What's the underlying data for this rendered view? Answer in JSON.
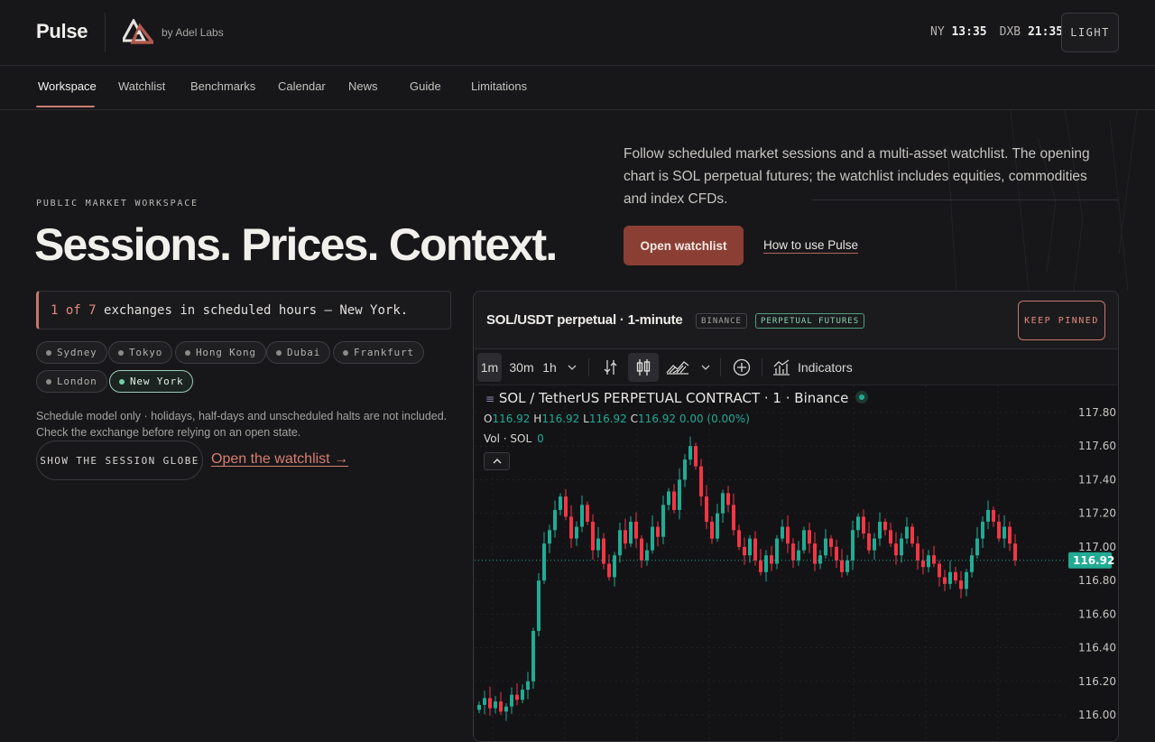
{
  "header": {
    "brand": "Pulse",
    "byline": "by Adel Labs",
    "clocks": [
      {
        "city": "NY",
        "time": "13:35"
      },
      {
        "city": "DXB",
        "time": "21:35"
      }
    ],
    "theme_toggle": "LIGHT"
  },
  "nav": {
    "items": [
      "Workspace",
      "Watchlist",
      "Benchmarks",
      "Calendar",
      "News",
      "Guide",
      "Limitations"
    ],
    "active": "Workspace"
  },
  "hero": {
    "eyebrow": "PUBLIC MARKET WORKSPACE",
    "headline": "Sessions. Prices. Context.",
    "intro": "Follow scheduled market sessions and a multi-asset watchlist. The opening chart is SOL perpetual futures; the watchlist includes equities, commodities and index CFDs.",
    "primary_cta": "Open watchlist",
    "secondary_link": "How to use Pulse"
  },
  "sessions": {
    "open_count": "1",
    "of_word": "of",
    "total": "7",
    "status_text": "exchanges in scheduled hours — New York.",
    "exchanges": [
      {
        "name": "Sydney",
        "open": false
      },
      {
        "name": "Tokyo",
        "open": false
      },
      {
        "name": "Hong Kong",
        "open": false
      },
      {
        "name": "Dubai",
        "open": false
      },
      {
        "name": "Frankfurt",
        "open": false
      },
      {
        "name": "London",
        "open": false
      },
      {
        "name": "New York",
        "open": true
      }
    ],
    "disclaimer_1": "Schedule model only · holidays, half-days and unscheduled halts are not included.",
    "disclaimer_2": "Check the exchange before relying on an open state.",
    "globe_button": "SHOW THE SESSION GLOBE",
    "watchlist_link": "Open the watchlist →"
  },
  "chart_panel": {
    "title": "SOL/USDT perpetual · 1-minute",
    "exchange_tag": "BINANCE",
    "type_tag": "PERPETUAL FUTURES",
    "pin_button": "KEEP PINNED",
    "toolbar": {
      "intervals": [
        "1m",
        "30m",
        "1h"
      ],
      "active_interval": "1m",
      "indicators_label": "Indicators"
    },
    "legend": {
      "symbol_line": "SOL / TetherUS PERPETUAL CONTRACT · 1 · Binance",
      "o_label": "O",
      "o": "116.92",
      "h_label": "H",
      "h": "116.92",
      "l_label": "L",
      "l": "116.92",
      "c_label": "C",
      "c": "116.92",
      "change": "0.00 (0.00%)",
      "vol_label": "Vol · SOL",
      "vol": "0"
    },
    "colors": {
      "up": "#22ab94",
      "down": "#f23645",
      "last_price": "#22ab94"
    }
  },
  "chart_data": {
    "type": "candlestick",
    "y_ticks": [
      "117.80",
      "117.60",
      "117.40",
      "117.20",
      "117.00",
      "116.80",
      "116.60",
      "116.40",
      "116.20",
      "116.00"
    ],
    "ylim": [
      116.0,
      117.8
    ],
    "last_price": "116.92",
    "close_series": [
      116.06,
      116.1,
      116.04,
      116.08,
      116.02,
      116.05,
      116.12,
      116.09,
      116.15,
      116.2,
      116.5,
      116.8,
      117.02,
      117.1,
      117.22,
      117.3,
      117.18,
      117.05,
      117.12,
      117.25,
      117.15,
      116.98,
      117.05,
      116.9,
      116.82,
      116.95,
      117.1,
      117.02,
      117.15,
      117.05,
      116.92,
      116.98,
      117.12,
      117.06,
      117.25,
      117.33,
      117.22,
      117.4,
      117.52,
      117.6,
      117.48,
      117.3,
      117.15,
      117.05,
      117.2,
      117.32,
      117.25,
      117.1,
      117.0,
      116.95,
      117.05,
      116.92,
      116.85,
      116.95,
      116.9,
      117.05,
      117.12,
      117.02,
      116.92,
      116.98,
      117.1,
      117.02,
      116.9,
      116.95,
      117.05,
      117.0,
      116.92,
      116.85,
      116.92,
      117.1,
      117.18,
      117.08,
      116.98,
      117.05,
      117.15,
      117.1,
      117.02,
      116.95,
      117.05,
      117.12,
      117.02,
      116.92,
      116.88,
      116.95,
      116.9,
      116.82,
      116.78,
      116.85,
      116.8,
      116.75,
      116.85,
      116.95,
      117.05,
      117.15,
      117.22,
      117.15,
      117.05,
      117.12,
      117.02,
      116.92
    ]
  }
}
